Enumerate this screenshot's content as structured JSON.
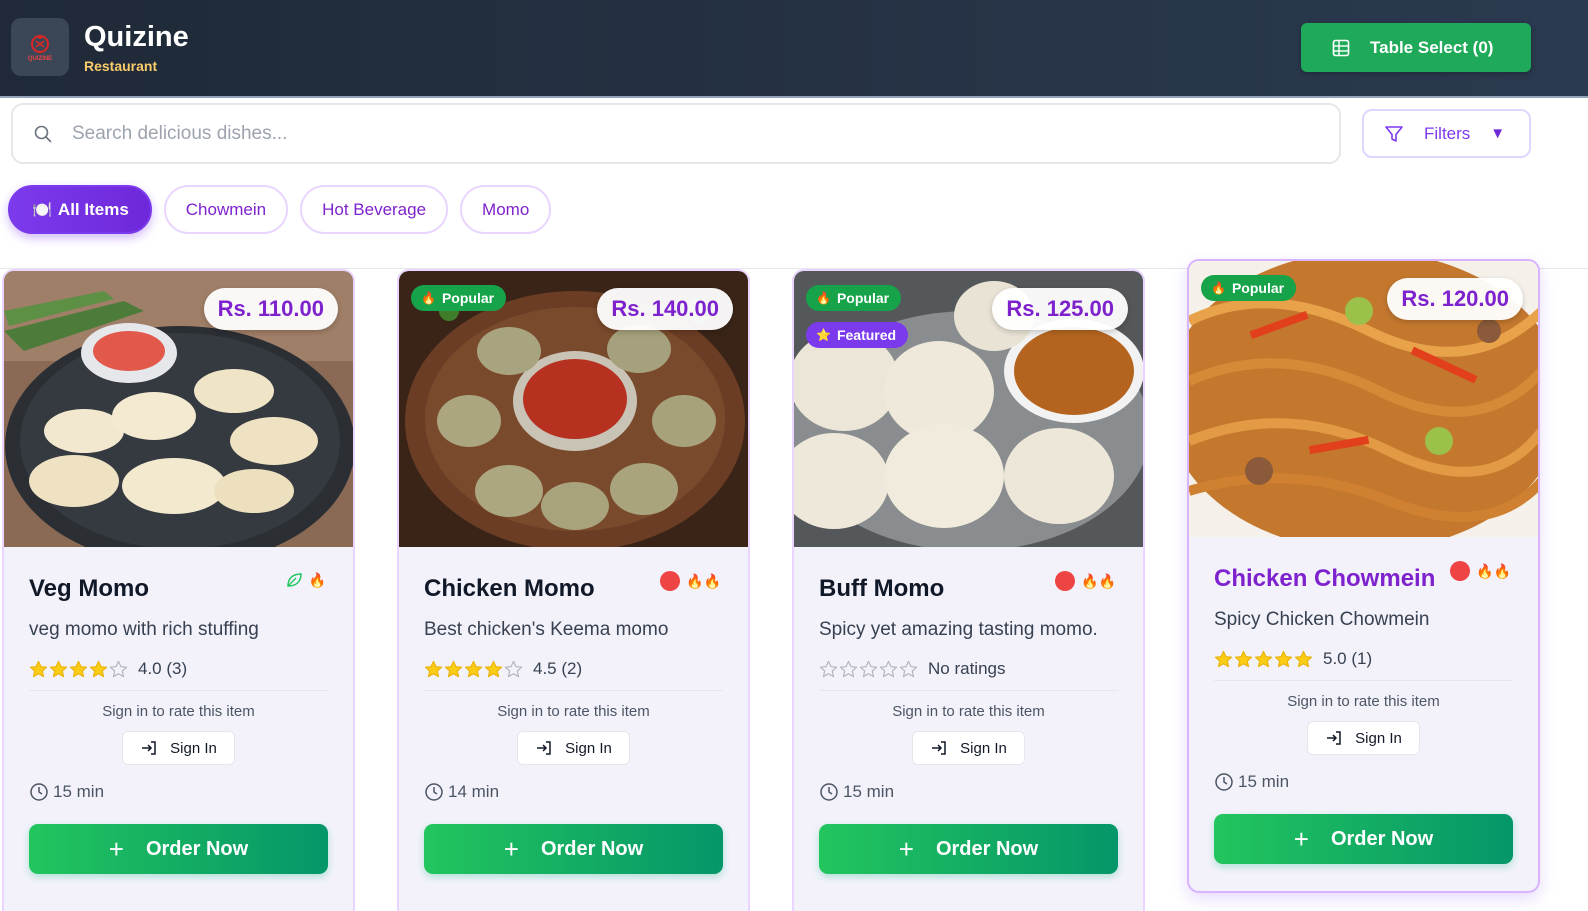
{
  "header": {
    "brand_name": "Quizine",
    "brand_sub": "Restaurant",
    "logo_text": "QUIZINE",
    "table_select_label": "Table Select (0)"
  },
  "search": {
    "placeholder": "Search delicious dishes..."
  },
  "filters": {
    "label": "Filters"
  },
  "categories": [
    {
      "label": "All Items",
      "emoji": "🍽️",
      "active": true
    },
    {
      "label": "Chowmein"
    },
    {
      "label": "Hot Beverage"
    },
    {
      "label": "Momo"
    }
  ],
  "colors": {
    "brand": "#7c3aed",
    "accent_green": "#1faa59",
    "header_bg": "#1f2937",
    "star": "#facc15",
    "spice": "#ef4444"
  },
  "items": [
    {
      "name": "Veg Momo",
      "price": "Rs. 110.00",
      "description": "veg momo with rich stuffing",
      "rating_value": 4,
      "rating_text": "4.0 (3)",
      "veg": true,
      "spice_level": 1,
      "spice_icon": "🔥",
      "time": "15 min",
      "signin_note": "Sign in to rate this item",
      "signin_label": "Sign In",
      "order_label": "Order Now",
      "badges": []
    },
    {
      "name": "Chicken Momo",
      "price": "Rs. 140.00",
      "description": "Best chicken's Keema momo",
      "rating_value": 4,
      "rating_text": "4.5 (2)",
      "veg": false,
      "spice_level": 2,
      "spice_icons": "🔥🔥",
      "time": "14 min",
      "signin_note": "Sign in to rate this item",
      "signin_label": "Sign In",
      "order_label": "Order Now",
      "badges": [
        {
          "label": "Popular",
          "icon": "🔥"
        }
      ]
    },
    {
      "name": "Buff Momo",
      "price": "Rs. 125.00",
      "description": "Spicy yet amazing tasting momo.",
      "rating_value": 0,
      "rating_text": "No ratings",
      "veg": false,
      "spice_level": 2,
      "spice_icons": "🔥🔥",
      "time": "15 min",
      "signin_note": "Sign in to rate this item",
      "signin_label": "Sign In",
      "order_label": "Order Now",
      "badges": [
        {
          "label": "Popular",
          "icon": "🔥"
        },
        {
          "label": "Featured",
          "icon": "⭐"
        }
      ]
    },
    {
      "name": "Chicken Chowmein",
      "price": "Rs. 120.00",
      "description": "Spicy Chicken Chowmein",
      "rating_value": 5,
      "rating_text": "5.0 (1)",
      "veg": false,
      "spice_level": 2,
      "spice_icons": "🔥🔥",
      "time": "15 min",
      "signin_note": "Sign in to rate this item",
      "signin_label": "Sign In",
      "order_label": "Order Now",
      "badges": [
        {
          "label": "Popular",
          "icon": "🔥"
        }
      ]
    }
  ]
}
